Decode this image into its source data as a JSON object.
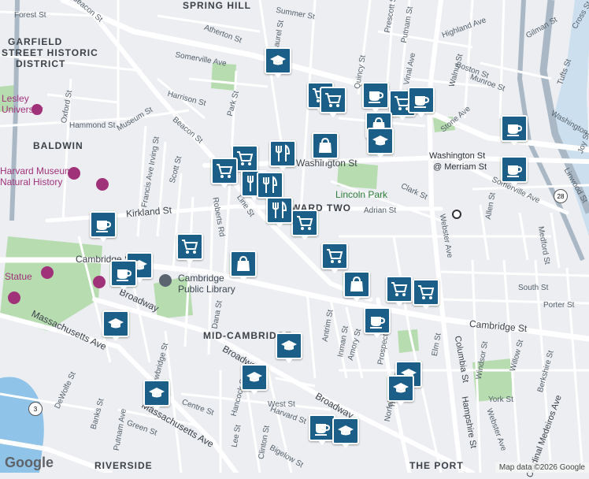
{
  "map": {
    "neighborhoods": [
      {
        "text": "SPRING HILL"
      },
      {
        "text": "GARFIELD"
      },
      {
        "text": "STREET HISTORIC"
      },
      {
        "text": "DISTRICT"
      },
      {
        "text": "BALDWIN"
      },
      {
        "text": "WARD TWO"
      },
      {
        "text": "MID-CAMBRIDGE"
      },
      {
        "text": "RIVERSIDE"
      },
      {
        "text": "THE PORT"
      }
    ],
    "street_labels": [
      "Forest St",
      "Beacon St",
      "Beacon St",
      "Summer St",
      "Prescott St",
      "Putnam St",
      "Vinal Ave",
      "Highland Ave",
      "Gilman St",
      "Cross St",
      "Atherton St",
      "Laurel St",
      "Quincy St",
      "Somerville Ave",
      "Somerville Ave",
      "Walnut St",
      "Boston St",
      "Munroe St",
      "Tufts St",
      "Harrison St",
      "Park St",
      "Oxford St",
      "Hammond St",
      "Museum St",
      "Stone Ave",
      "Washington St",
      "Washington St",
      "Joy St",
      "Irving St",
      "Francis Ave",
      "Scott St",
      "Clark St",
      "Adrian St",
      "Webster Ave",
      "Allen St",
      "Linwood St",
      "Medford St",
      "Kirkland St",
      "Line St",
      "Roberts Rd",
      "Cambridge St",
      "Cambridge St",
      "Dana St",
      "Trowbridge St",
      "Antrim St",
      "Inman St",
      "Amory St",
      "Prospect St",
      "South St",
      "Porter St",
      "Elm St",
      "Windsor St",
      "Willow St",
      "Berkshire St",
      "Broadway",
      "Broadway",
      "Broadway",
      "Massachusetts Ave",
      "Massachusetts Ave",
      "DeWolfe St",
      "Putnam Ave",
      "Banks St",
      "Green St",
      "Centre St",
      "Hancock St",
      "West St",
      "Harvard St",
      "Lee St",
      "Clinton St",
      "Bigelow St",
      "Columbia St",
      "Hampshire St",
      "Tremont St",
      "Norfolk St",
      "York St",
      "Webster Ave",
      "Cardinal Medeiros Ave"
    ],
    "parks": [
      {
        "text": "Lincoln Park"
      }
    ],
    "places": [
      {
        "text": "Harvard Museum"
      },
      {
        "text": "Natural History"
      },
      {
        "text": "Cambridge"
      },
      {
        "text": "Public Library"
      },
      {
        "text": "Statue"
      },
      {
        "text": "Lesley"
      },
      {
        "text": "University"
      }
    ],
    "transit_stop": {
      "line1": "Washington St",
      "line2": "@ Merriam St"
    },
    "route_shields": [
      "28",
      "3"
    ],
    "poi_markers": [
      {
        "icon": "education-icon"
      },
      {
        "icon": "shopping-cart-icon"
      },
      {
        "icon": "shopping-cart-icon"
      },
      {
        "icon": "cafe-icon"
      },
      {
        "icon": "shopping-cart-icon"
      },
      {
        "icon": "cafe-icon"
      },
      {
        "icon": "shopping-bag-icon"
      },
      {
        "icon": "education-icon"
      },
      {
        "icon": "cafe-icon"
      },
      {
        "icon": "cafe-icon"
      },
      {
        "icon": "shopping-bag-icon"
      },
      {
        "icon": "restaurant-icon"
      },
      {
        "icon": "shopping-cart-icon"
      },
      {
        "icon": "shopping-cart-icon"
      },
      {
        "icon": "restaurant-icon"
      },
      {
        "icon": "restaurant-icon"
      },
      {
        "icon": "shopping-cart-icon"
      },
      {
        "icon": "cafe-icon"
      },
      {
        "icon": "restaurant-icon"
      },
      {
        "icon": "shopping-cart-icon"
      },
      {
        "icon": "shopping-bag-icon"
      },
      {
        "icon": "education-icon"
      },
      {
        "icon": "cafe-icon"
      },
      {
        "icon": "shopping-cart-icon"
      },
      {
        "icon": "shopping-bag-icon"
      },
      {
        "icon": "shopping-cart-icon"
      },
      {
        "icon": "shopping-cart-icon"
      },
      {
        "icon": "cafe-icon"
      },
      {
        "icon": "education-icon"
      },
      {
        "icon": "education-icon"
      },
      {
        "icon": "education-icon"
      },
      {
        "icon": "education-icon"
      },
      {
        "icon": "education-icon"
      },
      {
        "icon": "education-icon"
      },
      {
        "icon": "cafe-icon"
      },
      {
        "icon": "education-icon"
      }
    ],
    "colors": {
      "background": "#eceef2",
      "marker": "#1b5f88",
      "park": "#b7dcb0",
      "water": "#8fc3e8",
      "highway": "#aab8c6",
      "road": "#ffffff"
    }
  },
  "logo": "Google",
  "attribution": "Map data ©2026 Google"
}
